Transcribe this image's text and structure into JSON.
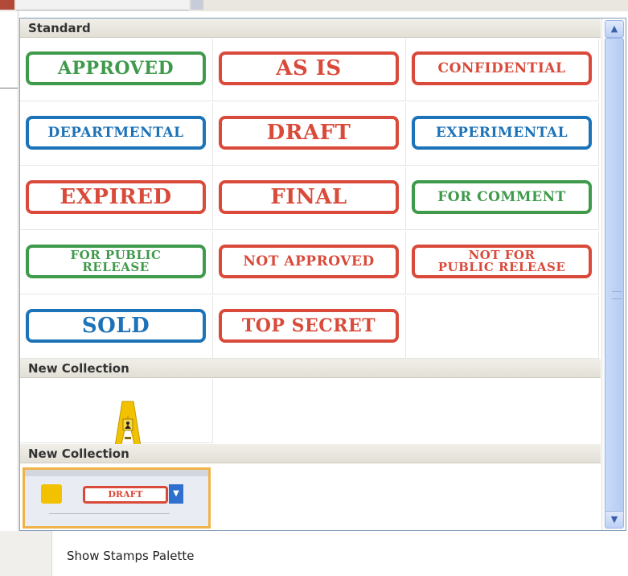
{
  "sections": [
    {
      "title": "Standard"
    },
    {
      "title": "New Collection"
    },
    {
      "title": "New Collection"
    }
  ],
  "standard_stamps": [
    {
      "label": "APPROVED",
      "color": "green"
    },
    {
      "label": "AS IS",
      "color": "red"
    },
    {
      "label": "CONFIDENTIAL",
      "color": "red"
    },
    {
      "label": "DEPARTMENTAL",
      "color": "blue"
    },
    {
      "label": "DRAFT",
      "color": "red"
    },
    {
      "label": "EXPERIMENTAL",
      "color": "blue"
    },
    {
      "label": "EXPIRED",
      "color": "red"
    },
    {
      "label": "FINAL",
      "color": "red"
    },
    {
      "label": "FOR COMMENT",
      "color": "green"
    },
    {
      "label": "FOR PUBLIC\nRELEASE",
      "color": "green"
    },
    {
      "label": "NOT APPROVED",
      "color": "red"
    },
    {
      "label": "NOT FOR\nPUBLIC RELEASE",
      "color": "red"
    },
    {
      "label": "SOLD",
      "color": "blue"
    },
    {
      "label": "TOP SECRET",
      "color": "red"
    }
  ],
  "collection2": {
    "thumbnail_stamp": "DRAFT",
    "selected": true
  },
  "menu": {
    "show_palette_label": "Show Stamps Palette"
  },
  "colors": {
    "green": "#3f9a4b",
    "red": "#d94a3a",
    "blue": "#1d73b8",
    "selection": "#f0b34a"
  },
  "icons": [
    "wet-floor-sign-icon",
    "scroll-up-icon",
    "scroll-down-icon"
  ]
}
